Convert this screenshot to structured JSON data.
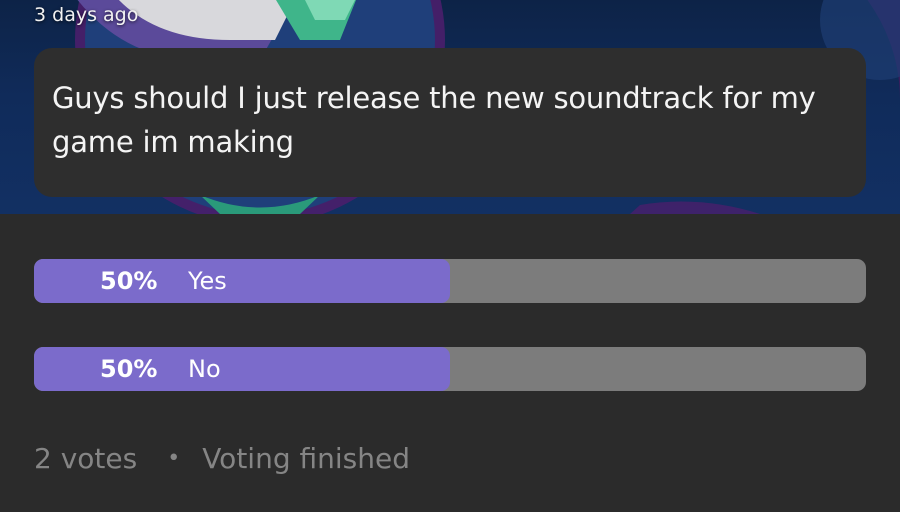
{
  "post": {
    "timestamp": "3 days ago",
    "question": "Guys should I just release the new soundtrack for my game im making"
  },
  "poll": {
    "options": [
      {
        "percent_label": "50%",
        "label": "Yes",
        "fill_fraction": 0.5
      },
      {
        "percent_label": "50%",
        "label": "No",
        "fill_fraction": 0.5
      }
    ],
    "votes_label": "2 votes",
    "separator": "•",
    "status": "Voting finished"
  },
  "colors": {
    "fill": "#7b6bcb",
    "track": "#7c7c7c",
    "background": "#2b2b2b",
    "card": "#2e2e2e"
  }
}
